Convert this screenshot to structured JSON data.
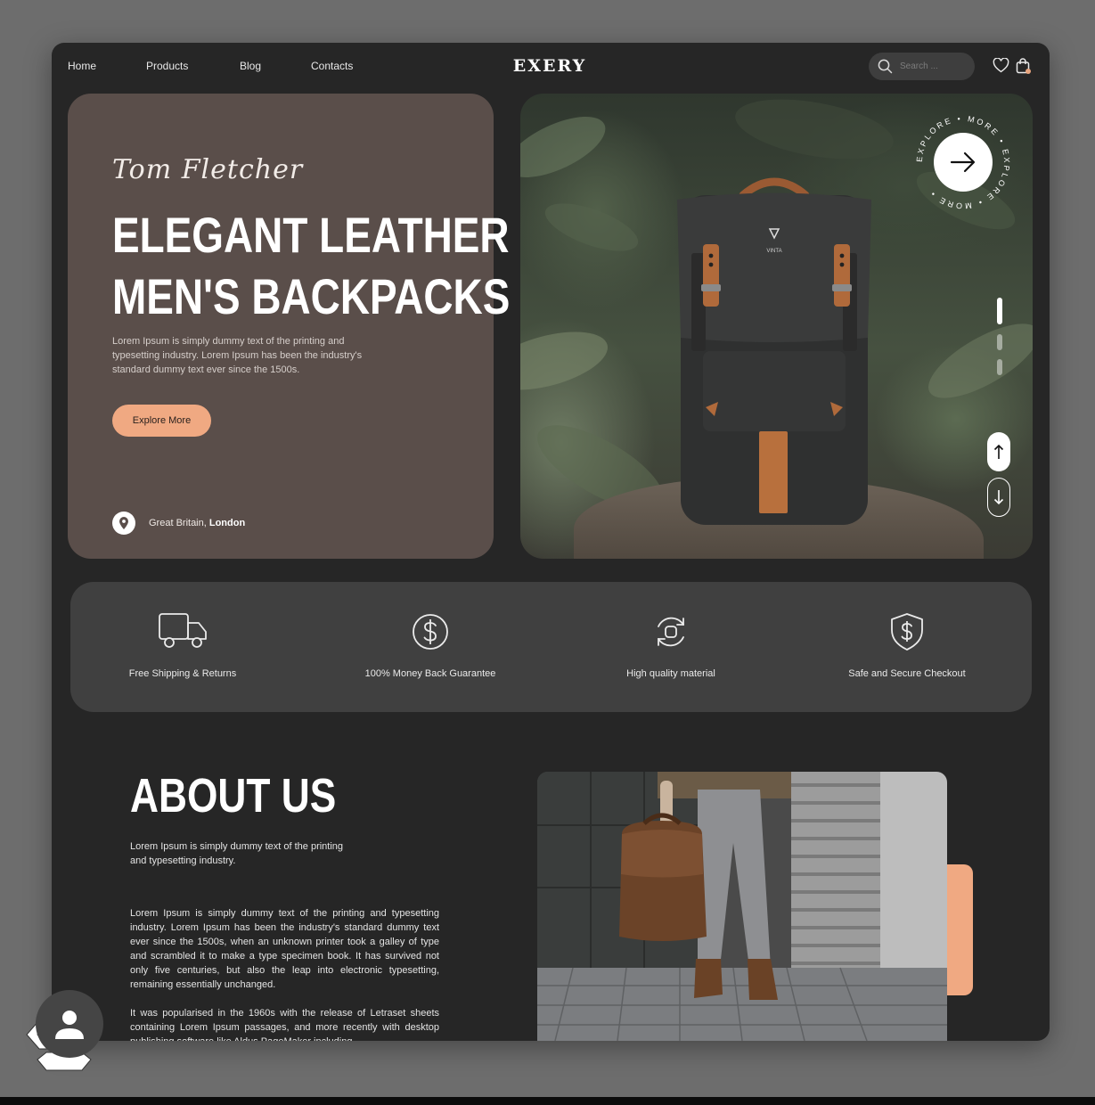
{
  "nav": {
    "links": [
      "Home",
      "Products",
      "Blog",
      "Contacts"
    ],
    "logo": "EXERY",
    "search_placeholder": "Search ..."
  },
  "hero": {
    "signature": "Tom Fletcher",
    "title_line1": "ELEGANT LEATHER",
    "title_line2": "MEN'S BACKPACKS",
    "description": "Lorem Ipsum is simply dummy text of the printing and typesetting industry. Lorem Ipsum has been the industry's standard dummy text ever since the 1500s.",
    "cta": "Explore More",
    "location_prefix": "Great Britain, ",
    "location_city": "London",
    "badge_text": "EXPLORE • MORE • EXPLORE • MORE •",
    "product_brand": "VINTA"
  },
  "features": [
    {
      "label": "Free Shipping & Returns",
      "icon": "truck-icon"
    },
    {
      "label": "100% Money Back Guarantee",
      "icon": "dollar-coin-icon"
    },
    {
      "label": "High quality material",
      "icon": "refresh-quality-icon"
    },
    {
      "label": "Safe and Secure Checkout",
      "icon": "shield-dollar-icon"
    }
  ],
  "about": {
    "title": "ABOUT US",
    "lead": "Lorem Ipsum is simply dummy text of the printing and typesetting industry.",
    "body1": "Lorem Ipsum is simply dummy text of the printing and typesetting industry. Lorem Ipsum has been the industry's standard dummy text ever since the 1500s, when an unknown printer took a galley of type and scrambled it to make a type specimen book. It has survived not only five centuries, but also the leap into electronic typesetting, remaining essentially unchanged.",
    "body2": "It was popularised in the 1960s with the release of Letraset sheets containing Lorem Ipsum passages, and more recently with desktop publishing software like Aldus PageMaker including"
  },
  "colors": {
    "page_bg": "#6d6d6d",
    "card_bg": "#262626",
    "hero_panel": "#5a4e4a",
    "accent": "#f0a982",
    "feature_bar": "#404040"
  }
}
